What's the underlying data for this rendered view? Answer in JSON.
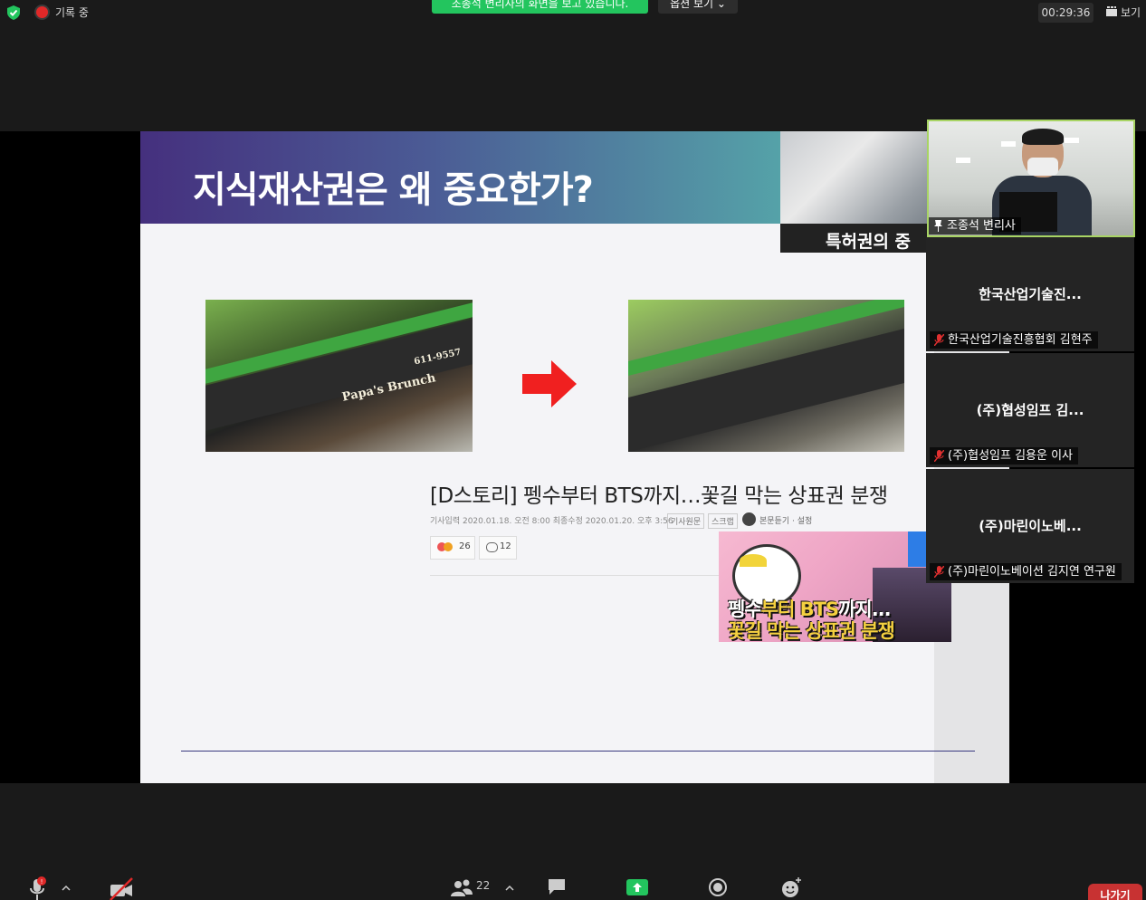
{
  "topbar": {
    "recording_label": "기록 중",
    "share_banner": "조종석 변리사의 화면을 보고 있습니다.",
    "options_label": "옵션 보기 ⌄",
    "timer": "00:29:36",
    "view_label": "보기"
  },
  "slide": {
    "title": "지식재산권은 왜 중요한가?",
    "deco_caption": "특허권의 중",
    "headline": "[D스토리] 펭수부터 BTS까지…꽃길 막는 상표권 분쟁",
    "meta": "기사입력 2020.01.18. 오전 8:00   최종수정 2020.01.20. 오후 3:56",
    "meta_tag1": "기사원문",
    "meta_tag2": "스크랩",
    "listen": "본문듣기 · 설정",
    "reactions_count": "26",
    "comments_count": "12",
    "sign_left_sub": "Papa's Brunch",
    "sign_left_phone": "611-9557",
    "thumb_line1a": "펭수",
    "thumb_line1b": "부터 BTS",
    "thumb_line1c": "까지...",
    "thumb_line2a": "꽃길 막는 ",
    "thumb_line2b": "상표권 분쟁"
  },
  "participants": [
    {
      "big_name": "",
      "chip": "조종석 변리사",
      "has_video": true
    },
    {
      "big_name": "한국산업기술진...",
      "chip": "한국산업기술진흥협회 김현주",
      "has_video": false
    },
    {
      "big_name": "(주)협성임프  김...",
      "chip": "(주)협성임프  김용운 이사",
      "has_video": false
    },
    {
      "big_name": "(주)마린이노베...",
      "chip": "(주)마린이노베이션 김지연 연구원",
      "has_video": false
    }
  ],
  "toolbar": {
    "participants_count": "22",
    "leave_label": "나가기",
    "icons": [
      "mic-muted-icon",
      "chevron-up-icon",
      "video-off-icon",
      "participants-icon",
      "chevron-up-icon",
      "chat-icon",
      "share-screen-icon",
      "record-icon",
      "reactions-icon"
    ]
  },
  "colors": {
    "accent_green": "#23c55e",
    "leave_red": "#c83232",
    "active_speaker": "#a8d464"
  }
}
